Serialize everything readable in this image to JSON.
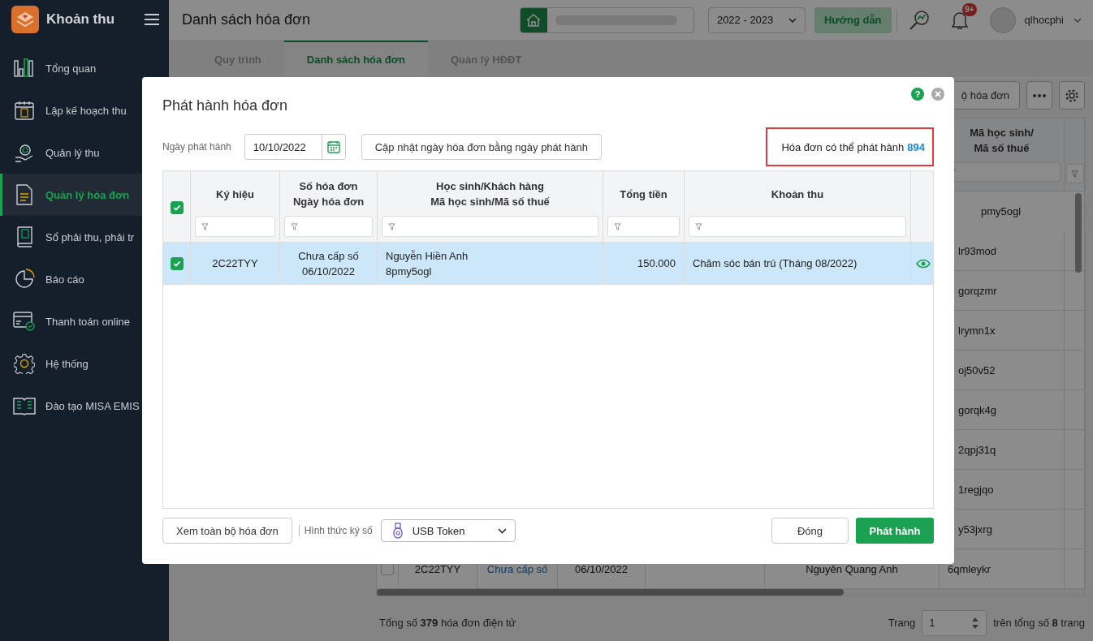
{
  "sidebar": {
    "app_name": "Khoản thu",
    "items": [
      {
        "label": "Tổng quan",
        "selected": false
      },
      {
        "label": "Lập kế hoạch thu",
        "selected": false
      },
      {
        "label": "Quản lý thu",
        "selected": false
      },
      {
        "label": "Quản lý hóa đơn",
        "selected": true
      },
      {
        "label": "Sổ phải thu, phải tr",
        "selected": false
      },
      {
        "label": "Báo cáo",
        "selected": false
      },
      {
        "label": "Thanh toán online",
        "selected": false
      },
      {
        "label": "Hệ thống",
        "selected": false
      },
      {
        "label": "Đào tạo MISA EMIS",
        "selected": false
      }
    ]
  },
  "header": {
    "title": "Danh sách hóa đơn",
    "school_year": "2022 - 2023",
    "guide_button": "Hướng dẫn",
    "notification_badge": "9+",
    "username": "qlhocphi"
  },
  "tabs": [
    {
      "label": "Quy trình",
      "selected": false
    },
    {
      "label": "Danh sách hóa đơn",
      "selected": true
    },
    {
      "label": "Quản lý HĐĐT",
      "selected": false
    }
  ],
  "toolbar": {
    "export_button": "ộ hóa đơn"
  },
  "invoice_table": {
    "code_header": [
      "Mã học sinh/",
      "Mã số thuế"
    ],
    "rows": [
      {
        "code": "pmy5ogl",
        "selected": true
      },
      {
        "code": "lr93mod",
        "selected": false
      },
      {
        "code": "gorqzmr",
        "selected": false
      },
      {
        "code": "lrymn1x",
        "selected": false
      },
      {
        "code": "oj50v52",
        "selected": false
      },
      {
        "code": "gorqk4g",
        "selected": false
      },
      {
        "code": "2qpj31q",
        "selected": false
      },
      {
        "code": "1regjqo",
        "selected": false
      },
      {
        "code": "y53jxrg",
        "selected": false
      },
      {
        "code": "6qmleykr",
        "selected": false,
        "checked": false,
        "symbol": "2C22TYY",
        "invoice_no": "Chưa cấp số",
        "date": "06/10/2022",
        "customer": "Nguyên Quang Anh"
      }
    ]
  },
  "status_bar": {
    "summary": "Tổng số **379** hóa đơn điện tử",
    "page_label": "Trang",
    "page": "1",
    "page_total": "trên tổng số **8** trang"
  },
  "dialog": {
    "title": "Phát hành hóa đơn",
    "help_icon": "?",
    "date_label": "Ngày phát hành",
    "date_value": "10/10/2022",
    "update_button": "Cập nhật ngày hóa đơn bằng ngày phát hành",
    "available_label": "Hóa đơn có thể phát hành",
    "available_count": "894",
    "select_all_checked": true,
    "columns": [
      {
        "lines": [
          "Ký hiệu"
        ]
      },
      {
        "lines": [
          "Số hóa đơn",
          "Ngày hóa đơn"
        ]
      },
      {
        "lines": [
          "Học sinh/Khách hàng",
          "Mã học sinh/Mã số thuế"
        ]
      },
      {
        "lines": [
          "Tổng tiền"
        ]
      },
      {
        "lines": [
          "Khoản thu"
        ]
      }
    ],
    "rows": [
      {
        "checked": true,
        "selected": true,
        "symbol": "2C22TYY",
        "invoice_no": "Chưa cấp số",
        "invoice_date": "06/10/2022",
        "customer": "Nguyễn Hiền Anh",
        "customer_code": "8pmy5ogl",
        "total": "150.000",
        "fee": "Chăm sóc bán trú (Tháng 08/2022)"
      }
    ],
    "view_all_button": "Xem toàn bộ hóa đơn",
    "sign_label": "Hình thức ký số",
    "sign_method": "USB Token",
    "close_button": "Đóng",
    "issue_button": "Phát hành"
  }
}
